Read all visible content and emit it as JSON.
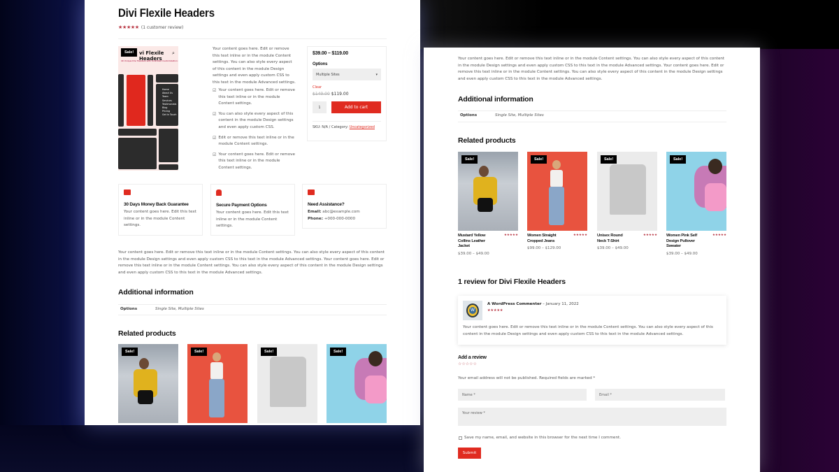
{
  "colors": {
    "accent": "#e02b20",
    "star": "#b7323f",
    "sale_badge": "#000000"
  },
  "product": {
    "title": "Divi Flexile Headers",
    "stars": "★★★★★",
    "review_count": "(1 customer review)",
    "sale_badge": "Sale!",
    "gallery_title": "vi Flexile Headers",
    "gallery_subtitle": "40 Unique Divi Headers with Unlimited Customization Options",
    "gallery_menu": [
      "Home",
      "About Us",
      "Team",
      "Services",
      "Testimonials",
      "Blog",
      "Pricing",
      "Get In Touch"
    ],
    "short_description": "Your content goes here. Edit or remove this text inline or in the module Content settings. You can also style every aspect of this content in the module Design settings and even apply custom CSS to this text in the module Advanced settings.",
    "checklist": [
      "Your content goes here. Edit or remove this text inline or in the module Content settings.",
      "You can also style every aspect of this content in the module Design settings and even apply custom CSS.",
      "Edit or remove this text inline or in the module Content settings.",
      "Your content goes here. Edit or remove this text inline or in the module Content settings."
    ],
    "price_range": "$39.00 – $119.00",
    "options_label": "Options",
    "options_selected": "Multiple Sites",
    "clear_label": "Clear",
    "old_price": "$149.00",
    "new_price": "$119.00",
    "quantity": "1",
    "add_to_cart": "Add to cart",
    "meta_prefix": "SKU: N/A / Category: ",
    "category": "Uncategorized"
  },
  "features": [
    {
      "icon": "wallet-icon",
      "title": "30 Days Money Back Guarantee",
      "text": "Your content goes here. Edit this text inline or in the module Content settings."
    },
    {
      "icon": "lock-icon",
      "title": "Secure Payment Options",
      "text": "Your content goes here. Edit this text inline or in the module Content settings."
    },
    {
      "icon": "contact-card-icon",
      "title": "Need Assistance?",
      "email_label": "Email:",
      "email": "abc@example.com",
      "phone_label": "Phone:",
      "phone": "+000-000-0000"
    }
  ],
  "long_description": "Your content goes here. Edit or remove this text inline or in the module Content settings. You can also style every aspect of this content in the module Design settings and even apply custom CSS to this text in the module Advanced settings. Your content goes here. Edit or remove this text inline or in the module Content settings. You can also style every aspect of this content in the module Design settings and even apply custom CSS to this text in the module Advanced settings.",
  "additional_info": {
    "heading": "Additional information",
    "label": "Options",
    "value": "Single Site, Multiple Sites"
  },
  "related": {
    "heading": "Related products",
    "items": [
      {
        "name": "Mustard Yellow Collins Leather Jacket",
        "price": "$39.00 – $49.00",
        "badge": "Sale!",
        "stars": "★★★★★"
      },
      {
        "name": "Women Straight Cropped Jeans",
        "price": "$99.00 – $129.00",
        "badge": "Sale!",
        "stars": "★★★★★"
      },
      {
        "name": "Unisex Round Neck T-Shirt",
        "price": "$39.00 – $49.00",
        "badge": "Sale!",
        "stars": "★★★★★"
      },
      {
        "name": "Women Pink Self Design Pullover Sweater",
        "price": "$39.00 – $49.00",
        "badge": "Sale!",
        "stars": "★★★★★"
      }
    ]
  },
  "reviews": {
    "heading": "1 review for Divi Flexile Headers",
    "items": [
      {
        "author": "A WordPress Commenter",
        "date": "– January 11, 2022",
        "stars": "★★★★★",
        "text": "Your content goes here. Edit or remove this text inline or in the module Content settings. You can also style every aspect of this content in the module Design settings and even apply custom CSS to this text in the module Advanced settings."
      }
    ]
  },
  "review_form": {
    "heading": "Add a review",
    "empty_stars": "☆☆☆☆☆",
    "notice": "Your email address will not be published. Required fields are marked *",
    "name_placeholder": "Name *",
    "email_placeholder": "Email *",
    "review_placeholder": "Your review *",
    "save_label": "Save my name, email, and website in this browser for the next time I comment.",
    "submit": "Submit"
  }
}
